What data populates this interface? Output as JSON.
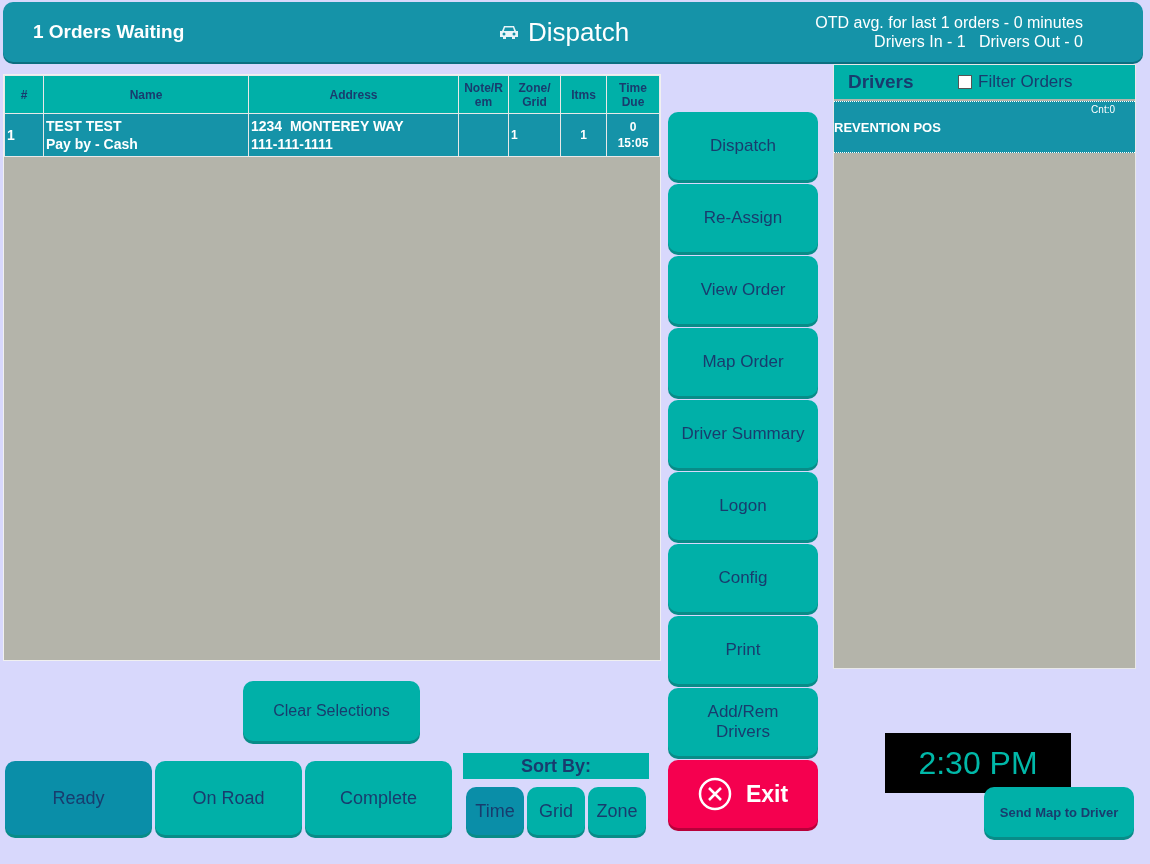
{
  "header": {
    "orders_waiting": "1 Orders Waiting",
    "title": "Dispatch",
    "stats": [
      "OTD avg. for last 1 orders - 0 minutes",
      "Drivers In - 1   Drivers Out - 0"
    ]
  },
  "orders_table": {
    "columns": [
      "#",
      "Name",
      "Address",
      "Note/R em",
      "Zone/ Grid",
      "Itms",
      "Time Due"
    ],
    "rows": [
      {
        "selected": true,
        "cells": [
          "1",
          "TEST TEST\nPay by - Cash",
          "1234  MONTEREY WAY\n111-111-1111",
          "",
          "1",
          "1",
          "0\n15:05"
        ]
      }
    ]
  },
  "actions": [
    {
      "label": "Dispatch",
      "kind": "normal"
    },
    {
      "label": "Re-Assign",
      "kind": "normal"
    },
    {
      "label": "View Order",
      "kind": "normal"
    },
    {
      "label": "Map Order",
      "kind": "normal"
    },
    {
      "label": "Driver Summary",
      "kind": "normal"
    },
    {
      "label": "Logon",
      "kind": "normal"
    },
    {
      "label": "Config",
      "kind": "normal"
    },
    {
      "label": "Print",
      "kind": "normal"
    },
    {
      "label": "Add/Rem\nDrivers",
      "kind": "normal"
    },
    {
      "label": "Exit",
      "kind": "exit"
    }
  ],
  "clear_button": "Clear Selections",
  "status_filters": [
    {
      "label": "Ready",
      "selected": true
    },
    {
      "label": "On Road",
      "selected": false
    },
    {
      "label": "Complete",
      "selected": false
    }
  ],
  "sort": {
    "label": "Sort By:",
    "options": [
      {
        "label": "Time",
        "selected": true
      },
      {
        "label": "Grid",
        "selected": false
      },
      {
        "label": "Zone",
        "selected": false
      }
    ]
  },
  "drivers": {
    "title": "Drivers",
    "filter": {
      "label": "Filter Orders",
      "checked": false
    },
    "items": [
      {
        "name": "REVENTION POS",
        "count": "Cnt:0",
        "selected": true
      }
    ]
  },
  "clock": "2:30 PM",
  "send_map_button": "Send Map to Driver"
}
